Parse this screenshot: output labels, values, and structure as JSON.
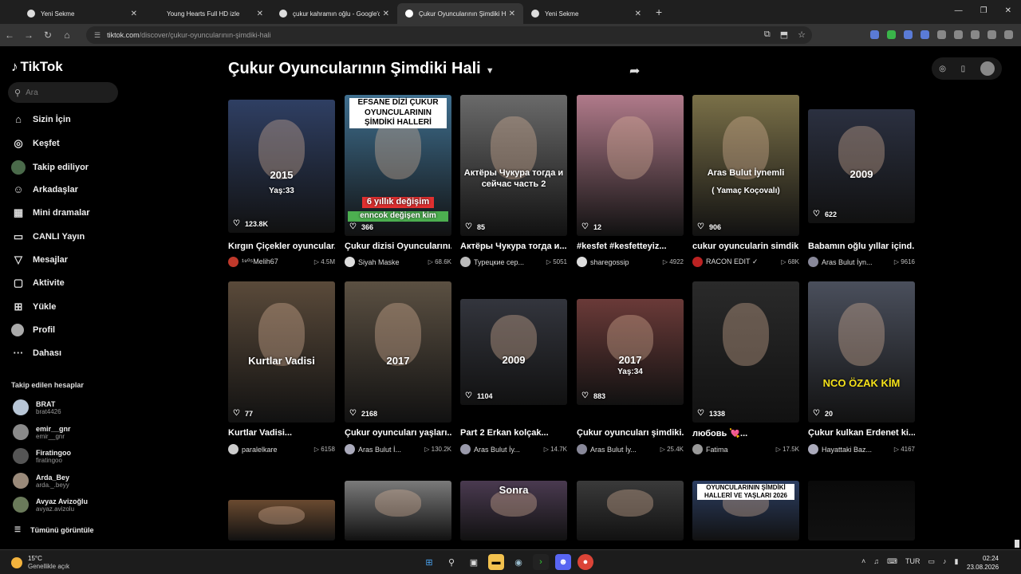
{
  "browser": {
    "tabs": [
      {
        "title": "Yeni Sekme",
        "active": false
      },
      {
        "title": "Young Hearts Full HD izle",
        "active": false
      },
      {
        "title": "çukur kahramın oğlu - Google'da",
        "active": false
      },
      {
        "title": "Çukur Oyuncularının Şimdiki Hali",
        "active": true
      },
      {
        "title": "Yeni Sekme",
        "active": false
      }
    ],
    "new_tab": "+",
    "url_domain": "tiktok.com",
    "url_path": "/discover/çukur-oyuncularının-şimdiki-hali"
  },
  "sidebar": {
    "logo": "TikTok",
    "search_placeholder": "Ara",
    "nav": [
      {
        "label": "Sizin İçin",
        "icon": "home-icon"
      },
      {
        "label": "Keşfet",
        "icon": "compass-icon"
      },
      {
        "label": "Takip ediliyor",
        "icon": "following-icon"
      },
      {
        "label": "Arkadaşlar",
        "icon": "friends-icon"
      },
      {
        "label": "Mini dramalar",
        "icon": "film-icon"
      },
      {
        "label": "CANLI Yayın",
        "icon": "tv-icon"
      },
      {
        "label": "Mesajlar",
        "icon": "send-icon"
      },
      {
        "label": "Aktivite",
        "icon": "activity-icon"
      },
      {
        "label": "Yükle",
        "icon": "upload-icon"
      },
      {
        "label": "Profil",
        "icon": "profile-icon"
      },
      {
        "label": "Dahası",
        "icon": "more-icon"
      }
    ],
    "following_header": "Takip edilen hesaplar",
    "following": [
      {
        "name": "BRAT",
        "handle": "brat4426"
      },
      {
        "name": "emir__gnr",
        "handle": "emir__gnr"
      },
      {
        "name": "Firatingoo",
        "handle": "firatingoo"
      },
      {
        "name": "Arda_Bey",
        "handle": "arda._.beyy"
      },
      {
        "name": "Avyaz Avizoğlu",
        "handle": "avyaz.avizolu"
      }
    ],
    "see_all": "Tümünü görüntüle"
  },
  "main": {
    "title": "Çukur Oyuncularının Şimdiki Hali",
    "videos": [
      {
        "likes": "123.8K",
        "desc": "Kırgın Çiçekler oyuncular...",
        "user": "¹⁹⁰⁵Melih67",
        "views": "4.5M",
        "overlay": "2015",
        "overlay2": "Yaş:33",
        "color": "#2f3f63"
      },
      {
        "likes": "366",
        "desc": "Çukur dizisi Oyuncularını...",
        "user": "Siyah Maske",
        "views": "68.6K",
        "overlay": "EFSANE DİZİ ÇUKUR OYUNCULARININ ŞİMDİKİ HALLERİ",
        "overlay2": "6 yıllık değişim",
        "overlay3": "enncok değişen kim",
        "color": "#3f6f8f"
      },
      {
        "likes": "85",
        "desc": "Актёры Чукура тогда и...",
        "user": "Турецкие сер...",
        "views": "5051",
        "overlay": "Актёры Чукура тогда и сейчас часть 2",
        "color": "#6a6a6a"
      },
      {
        "likes": "12",
        "desc": "#kesfet #kesfetteyiz...",
        "user": "sharegossip",
        "views": "4922",
        "color": "#b07a8a"
      },
      {
        "likes": "906",
        "desc": "cukur oyuncularin simdik...",
        "user": "RACON EDIT ✓",
        "views": "68K",
        "overlay": "Aras Bulut İynemli",
        "overlay2": "( Yamaç Koçovalı)",
        "color": "#7a7048"
      },
      {
        "likes": "622",
        "desc": "Babamın oğlu yıllar içind...",
        "user": "Aras Bulut İyn...",
        "views": "9616",
        "overlay": "2009",
        "color": "#2b3040"
      },
      {
        "likes": "77",
        "desc": "Kurtlar Vadisi...",
        "user": "paralelkare",
        "views": "6158",
        "overlay": "Kurtlar Vadisi",
        "color": "#5a4a3a"
      },
      {
        "likes": "2168",
        "desc": "Çukur oyuncuları yaşları...",
        "user": "Aras Bulut İ...",
        "views": "130.2K",
        "overlay": "2017",
        "color": "#5b5042"
      },
      {
        "likes": "1104",
        "desc": "Part 2 Erkan kolçak...",
        "user": "Aras Bulut İy...",
        "views": "14.7K",
        "overlay": "2009",
        "color": "#33353d"
      },
      {
        "likes": "883",
        "desc": "Çukur oyuncuları şimdiki...",
        "user": "Aras Bulut İy...",
        "views": "25.4K",
        "overlay": "2017",
        "overlay2": "Yaş:34",
        "color": "#6a3a38"
      },
      {
        "likes": "1338",
        "desc": "любовь 💘...",
        "user": "Fatima",
        "views": "17.5K",
        "color": "#2a2a2a"
      },
      {
        "likes": "20",
        "desc": "Çukur kulkan Erdenet ki...",
        "user": "Hayattaki Baz...",
        "views": "4167",
        "overlay": "NCO ÖZAK KİM",
        "color": "#4a4f5c"
      },
      {
        "color": "#6a4a30"
      },
      {
        "color": "#7a7a7a"
      },
      {
        "overlay": "Sonra",
        "color": "#4a3a50"
      },
      {
        "color": "#3a3a3a"
      },
      {
        "overlay": "OYUNCULARININ ŞİMDİKİ HALLERİ VE YAŞLARI 2026",
        "color": "#2c3e62"
      },
      {
        "color": "#0a0a0a"
      }
    ]
  },
  "taskbar": {
    "temp": "15°C",
    "weather": "Genellikle açık",
    "lang": "TUR",
    "time": "02:24",
    "date": "23.08.2026"
  }
}
